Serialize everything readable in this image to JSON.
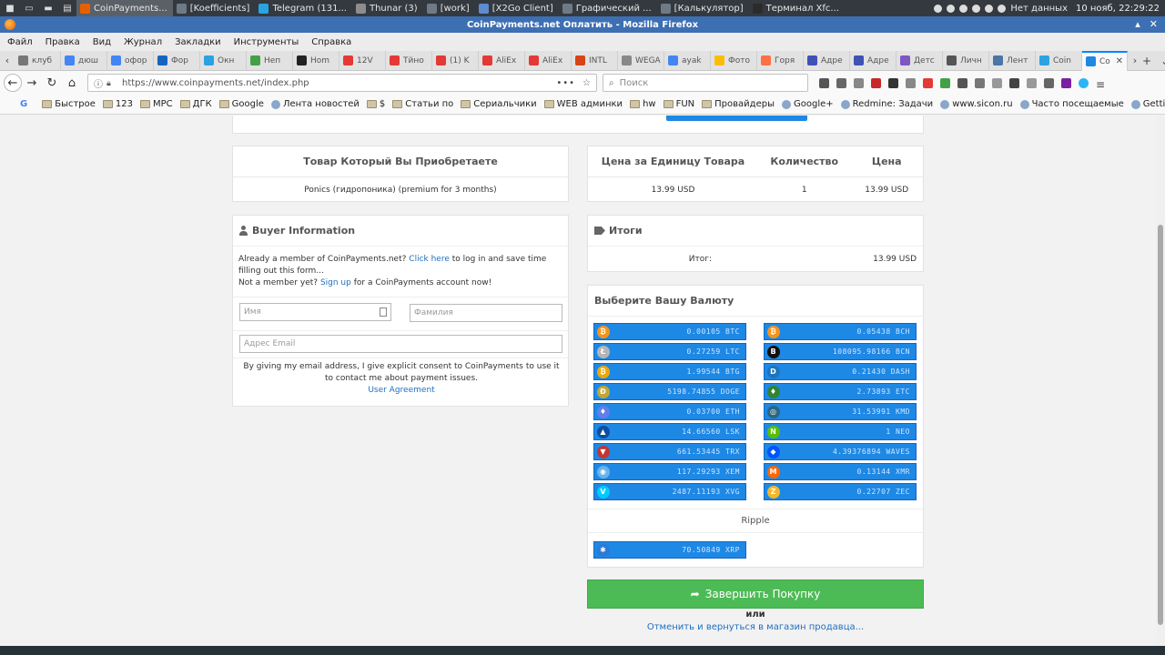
{
  "taskbar": {
    "tasks": [
      {
        "label": "CoinPayments...",
        "color": "#e66000",
        "active": true
      },
      {
        "label": "[Koefficients]",
        "color": "#6f7a86",
        "active": false
      },
      {
        "label": "Telegram (131...",
        "color": "#2aa3e0",
        "active": false
      },
      {
        "label": "Thunar (3)",
        "color": "#8d8d8d",
        "active": false
      },
      {
        "label": "[work]",
        "color": "#6f7a86",
        "active": false
      },
      {
        "label": "[X2Go Client]",
        "color": "#5d8dcc",
        "active": false
      },
      {
        "label": "Графический ...",
        "color": "#6f7a86",
        "active": false
      },
      {
        "label": "[Калькулятор]",
        "color": "#6f7a86",
        "active": false
      },
      {
        "label": "Терминал Xfc...",
        "color": "#2b2b2b",
        "active": false
      }
    ],
    "network_label": "Нет данных",
    "clock": "10 нояб, 22:29:22"
  },
  "window": {
    "title": "CoinPayments.net Оплатить - Mozilla Firefox"
  },
  "menubar": {
    "items": [
      "Файл",
      "Правка",
      "Вид",
      "Журнал",
      "Закладки",
      "Инструменты",
      "Справка"
    ]
  },
  "tabs": [
    {
      "label": "клуб",
      "color": "#777777"
    },
    {
      "label": "дюш",
      "color": "#4285f4"
    },
    {
      "label": "офор",
      "color": "#4285f4"
    },
    {
      "label": "Фор",
      "color": "#1565c0"
    },
    {
      "label": "Окн",
      "color": "#2aa3e0"
    },
    {
      "label": "Неп",
      "color": "#43a047"
    },
    {
      "label": "Hom",
      "color": "#222222"
    },
    {
      "label": "12V",
      "color": "#e53935"
    },
    {
      "label": "Тйно",
      "color": "#e53935"
    },
    {
      "label": "(1) K",
      "color": "#e53935"
    },
    {
      "label": "AliEx",
      "color": "#e53935"
    },
    {
      "label": "AliEx",
      "color": "#e53935"
    },
    {
      "label": "INTL",
      "color": "#d84315"
    },
    {
      "label": "WEGA",
      "color": "#888888"
    },
    {
      "label": "ayak",
      "color": "#4285f4"
    },
    {
      "label": "Фото",
      "color": "#fbbc05"
    },
    {
      "label": "Горя",
      "color": "#ff7043"
    },
    {
      "label": "Адре",
      "color": "#3f51b5"
    },
    {
      "label": "Адре",
      "color": "#3f51b5"
    },
    {
      "label": "Детс",
      "color": "#7e57c2"
    },
    {
      "label": "Личн",
      "color": "#555555"
    },
    {
      "label": "Лент",
      "color": "#4a76a8"
    },
    {
      "label": "Coin",
      "color": "#2aa3e0"
    },
    {
      "label": "Co",
      "color": "#1e88e5"
    }
  ],
  "navbar": {
    "url": "https://www.coinpayments.net/index.php",
    "search_placeholder": "Поиск"
  },
  "bookmarks": [
    {
      "label": "Быстрое",
      "folder": true
    },
    {
      "label": "123",
      "folder": true
    },
    {
      "label": "MPC",
      "folder": true
    },
    {
      "label": "ДГК",
      "folder": true
    },
    {
      "label": "Google",
      "folder": true
    },
    {
      "label": "Лента новостей",
      "folder": false
    },
    {
      "label": "$",
      "folder": true
    },
    {
      "label": "Статьи по",
      "folder": true
    },
    {
      "label": "Сериальчики",
      "folder": true
    },
    {
      "label": "WEB админки",
      "folder": true
    },
    {
      "label": "hw",
      "folder": true
    },
    {
      "label": "FUN",
      "folder": true
    },
    {
      "label": "Провайдеры",
      "folder": true
    },
    {
      "label": "Google+",
      "folder": false
    },
    {
      "label": "Redmine: Задачи",
      "folder": false
    },
    {
      "label": "www.sicon.ru",
      "folder": false
    },
    {
      "label": "Часто посещаемые",
      "folder": false
    },
    {
      "label": "Getting Started",
      "folder": false
    }
  ],
  "product": {
    "header": "Товар Который Вы Приобретаете",
    "name": "Ponics (гидропоника) (premium for 3 months)"
  },
  "price": {
    "unit_header": "Цена за Единицу Товара",
    "qty_header": "Количество",
    "price_header": "Цена",
    "unit_value": "13.99 USD",
    "qty_value": "1",
    "price_value": "13.99 USD"
  },
  "buyer": {
    "title": "Buyer Information",
    "member_prefix": "Already a member of CoinPayments.net?",
    "click_here": "Click here",
    "member_suffix": "to log in and save time filling out this form...",
    "notmember_prefix": "Not a member yet?",
    "sign_up": "Sign up",
    "notmember_suffix": "for a CoinPayments account now!",
    "first_name_placeholder": "Имя",
    "last_name_placeholder": "Фамилия",
    "email_placeholder": "Адрес Email",
    "consent": "By giving my email address, I give explicit consent to CoinPayments to use it to contact me about payment issues.",
    "agreement": "User Agreement"
  },
  "totals": {
    "title": "Итоги",
    "label": "Итог:",
    "value": "13.99 USD"
  },
  "currency": {
    "title": "Выберите Вашу Валюту",
    "coins": [
      {
        "amount": "0.00105 BTC",
        "icon": "bitcoin-icon",
        "color": "#f7931a",
        "glyph": "₿"
      },
      {
        "amount": "0.05438 BCH",
        "icon": "bitcoin-cash-icon",
        "color": "#f7931a",
        "glyph": "₿"
      },
      {
        "amount": "0.27259 LTC",
        "icon": "litecoin-icon",
        "color": "#b5b5b5",
        "glyph": "Ł"
      },
      {
        "amount": "108095.98166 BCN",
        "icon": "bytecoin-icon",
        "color": "#111111",
        "glyph": "B"
      },
      {
        "amount": "1.99544 BTG",
        "icon": "bitcoin-gold-icon",
        "color": "#eba809",
        "glyph": "₿"
      },
      {
        "amount": "0.21430 DASH",
        "icon": "dash-icon",
        "color": "#1c75bc",
        "glyph": "D"
      },
      {
        "amount": "5198.74855 DOGE",
        "icon": "dogecoin-icon",
        "color": "#c2a633",
        "glyph": "Ð"
      },
      {
        "amount": "2.73893 ETC",
        "icon": "ethereum-classic-icon",
        "color": "#328332",
        "glyph": "♦"
      },
      {
        "amount": "0.03700 ETH",
        "icon": "ethereum-icon",
        "color": "#627eea",
        "glyph": "♦"
      },
      {
        "amount": "31.53991 KMD",
        "icon": "komodo-icon",
        "color": "#2b6680",
        "glyph": "◎"
      },
      {
        "amount": "14.66560 LSK",
        "icon": "lisk-icon",
        "color": "#0d4ea0",
        "glyph": "▲"
      },
      {
        "amount": "1 NEO",
        "icon": "neo-icon",
        "color": "#58bf00",
        "glyph": "N"
      },
      {
        "amount": "661.53445 TRX",
        "icon": "tron-icon",
        "color": "#c23631",
        "glyph": "▼"
      },
      {
        "amount": "4.39376894 WAVES",
        "icon": "waves-icon",
        "color": "#0055ff",
        "glyph": "◆"
      },
      {
        "amount": "117.29293 XEM",
        "icon": "nem-icon",
        "color": "#67b2e8",
        "glyph": "◉"
      },
      {
        "amount": "0.13144 XMR",
        "icon": "monero-icon",
        "color": "#ff6600",
        "glyph": "M"
      },
      {
        "amount": "2487.11193 XVG",
        "icon": "verge-icon",
        "color": "#00cbff",
        "glyph": "V"
      },
      {
        "amount": "0.22707 ZEC",
        "icon": "zcash-icon",
        "color": "#f4b728",
        "glyph": "Z"
      }
    ],
    "ripple_label": "Ripple",
    "ripple_coin": {
      "amount": "70.50849 XRP",
      "icon": "ripple-icon",
      "color": "#2b7bd6",
      "glyph": "✱"
    }
  },
  "actions": {
    "finish": "Завершить Покупку",
    "or": "или",
    "cancel": "Отменить и вернуться в магазин продавца..."
  }
}
